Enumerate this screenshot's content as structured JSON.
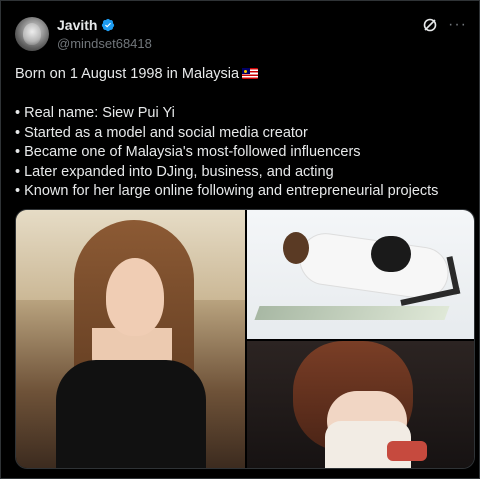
{
  "post": {
    "author": {
      "display_name": "Javith",
      "handle": "@mindset68418",
      "verified": true
    },
    "icons": {
      "verified": "verified-badge-icon",
      "grok": "grok-icon",
      "more": "more-icon"
    },
    "more_glyph": "···",
    "lines": [
      "Born on 1 August 1998 in Malaysia",
      "",
      "• Real name: Siew Pui Yi",
      "• Started as a model and social media creator",
      "• Became one of Malaysia's most-followed influencers",
      "• Later expanded into DJing, business, and acting",
      "• Known for her large online following and entrepreneurial projects"
    ],
    "media_count": 3,
    "colors": {
      "background": "#000000",
      "text": "#e7e9ea",
      "muted": "#71767b",
      "verified_blue": "#1d9bf0",
      "border": "#2f3336"
    }
  }
}
